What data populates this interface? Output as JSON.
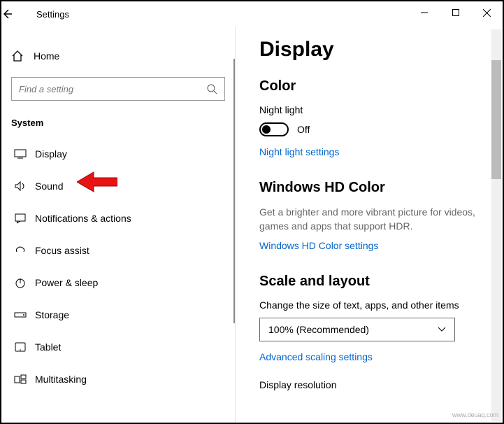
{
  "window": {
    "title": "Settings"
  },
  "sidebar": {
    "home": "Home",
    "search_placeholder": "Find a setting",
    "category": "System",
    "items": [
      {
        "label": "Display"
      },
      {
        "label": "Sound"
      },
      {
        "label": "Notifications & actions"
      },
      {
        "label": "Focus assist"
      },
      {
        "label": "Power & sleep"
      },
      {
        "label": "Storage"
      },
      {
        "label": "Tablet"
      },
      {
        "label": "Multitasking"
      }
    ]
  },
  "main": {
    "title": "Display",
    "color": {
      "heading": "Color",
      "night_light_label": "Night light",
      "night_light_state": "Off",
      "night_light_link": "Night light settings"
    },
    "hd": {
      "heading": "Windows HD Color",
      "desc": "Get a brighter and more vibrant picture for videos, games and apps that support HDR.",
      "link": "Windows HD Color settings"
    },
    "scale": {
      "heading": "Scale and layout",
      "label": "Change the size of text, apps, and other items",
      "value": "100% (Recommended)",
      "link": "Advanced scaling settings",
      "resolution_label": "Display resolution"
    }
  },
  "watermark": "www.deuaq.com"
}
